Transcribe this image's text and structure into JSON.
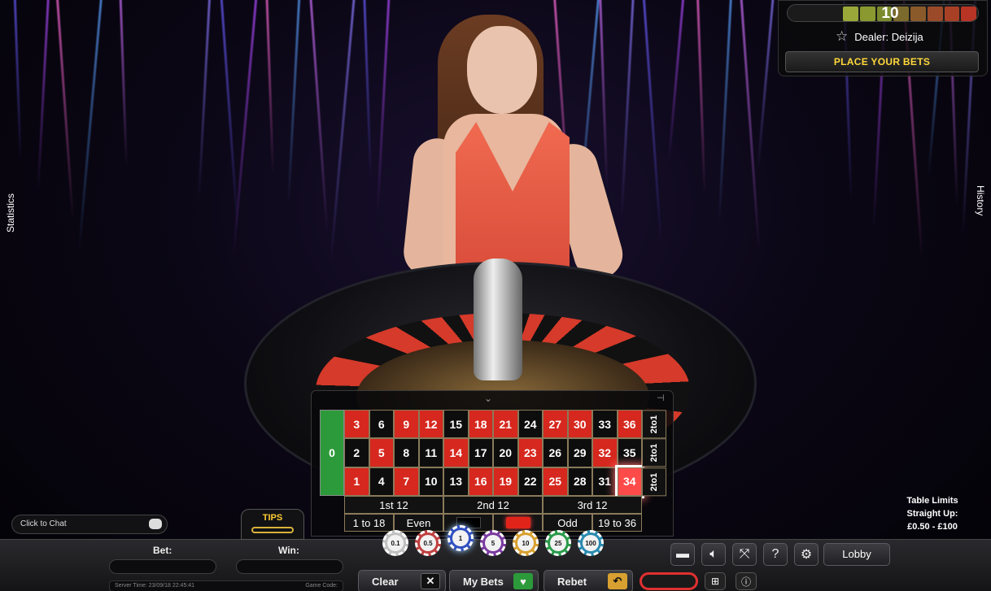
{
  "timer": {
    "value": "10",
    "segments": [
      "#9aa83a",
      "#8a9a30",
      "#7a8a2c",
      "#7c6a2c",
      "#8a5a2a",
      "#9a4a28",
      "#a84026",
      "#b83424"
    ]
  },
  "dealer": {
    "label": "Dealer: Deizija"
  },
  "status": {
    "message": "PLACE YOUR BETS"
  },
  "side_tabs": {
    "left": "Statistics",
    "right": "History"
  },
  "board": {
    "zero": "0",
    "rows": [
      [
        {
          "n": "3",
          "c": "r"
        },
        {
          "n": "6",
          "c": "b"
        },
        {
          "n": "9",
          "c": "r"
        },
        {
          "n": "12",
          "c": "r"
        },
        {
          "n": "15",
          "c": "b"
        },
        {
          "n": "18",
          "c": "r"
        },
        {
          "n": "21",
          "c": "r"
        },
        {
          "n": "24",
          "c": "b"
        },
        {
          "n": "27",
          "c": "r"
        },
        {
          "n": "30",
          "c": "r"
        },
        {
          "n": "33",
          "c": "b"
        },
        {
          "n": "36",
          "c": "r"
        }
      ],
      [
        {
          "n": "2",
          "c": "b"
        },
        {
          "n": "5",
          "c": "r"
        },
        {
          "n": "8",
          "c": "b"
        },
        {
          "n": "11",
          "c": "b"
        },
        {
          "n": "14",
          "c": "r"
        },
        {
          "n": "17",
          "c": "b"
        },
        {
          "n": "20",
          "c": "b"
        },
        {
          "n": "23",
          "c": "r"
        },
        {
          "n": "26",
          "c": "b"
        },
        {
          "n": "29",
          "c": "b"
        },
        {
          "n": "32",
          "c": "r"
        },
        {
          "n": "35",
          "c": "b"
        }
      ],
      [
        {
          "n": "1",
          "c": "r"
        },
        {
          "n": "4",
          "c": "b"
        },
        {
          "n": "7",
          "c": "r"
        },
        {
          "n": "10",
          "c": "b"
        },
        {
          "n": "13",
          "c": "b"
        },
        {
          "n": "16",
          "c": "r"
        },
        {
          "n": "19",
          "c": "r"
        },
        {
          "n": "22",
          "c": "b"
        },
        {
          "n": "25",
          "c": "r"
        },
        {
          "n": "28",
          "c": "b"
        },
        {
          "n": "31",
          "c": "b"
        },
        {
          "n": "34",
          "c": "r",
          "hot": true
        }
      ]
    ],
    "columns": [
      "2to1",
      "2to1",
      "2to1"
    ],
    "dozens": [
      "1st 12",
      "2nd 12",
      "3rd 12"
    ],
    "outside": [
      {
        "label": "1 to 18"
      },
      {
        "label": "Even"
      },
      {
        "label": "",
        "swatch": "black"
      },
      {
        "label": "",
        "swatch": "red"
      },
      {
        "label": "Odd"
      },
      {
        "label": "19 to 36"
      }
    ]
  },
  "chips": [
    {
      "value": "0.1",
      "color": "#c0c0c0"
    },
    {
      "value": "0.5",
      "color": "#c04040"
    },
    {
      "value": "1",
      "color": "#3050c0",
      "selected": true
    },
    {
      "value": "5",
      "color": "#7a3aa0"
    },
    {
      "value": "10",
      "color": "#d8a030"
    },
    {
      "value": "25",
      "color": "#2a9a4a"
    },
    {
      "value": "100",
      "color": "#2a8ab0"
    }
  ],
  "chat": {
    "placeholder": "Click to Chat"
  },
  "tips": {
    "label": "TIPS"
  },
  "bet": {
    "label": "Bet:",
    "value": ""
  },
  "win": {
    "label": "Win:",
    "value": ""
  },
  "status_line": {
    "left": "Server Time: 23/09/18 22:45:41",
    "right": "Game Code:"
  },
  "actions": {
    "clear": "Clear",
    "my_bets": "My Bets",
    "rebet": "Rebet",
    "lobby": "Lobby"
  },
  "limits": {
    "title": "Table Limits",
    "type": "Straight Up:",
    "range": "£0.50 - £100"
  },
  "colors": {
    "accent_yellow": "#ffd83a",
    "table_green": "#2c9a3a",
    "red": "#d6281e"
  }
}
